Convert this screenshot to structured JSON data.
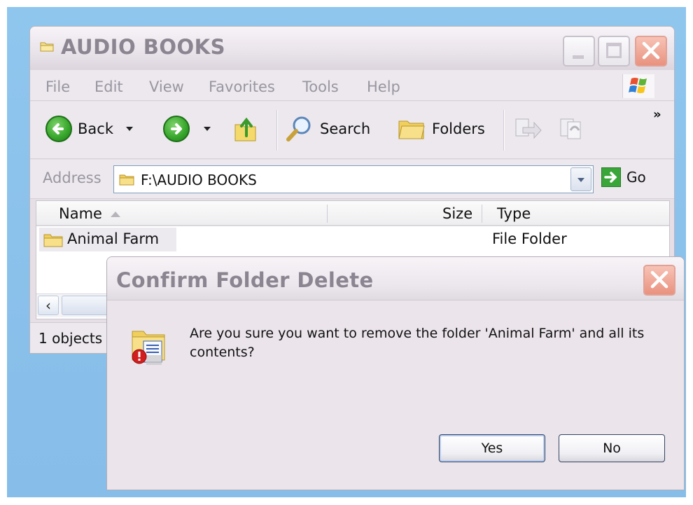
{
  "explorer": {
    "title": "AUDIO BOOKS",
    "menu": [
      "File",
      "Edit",
      "View",
      "Favorites",
      "Tools",
      "Help"
    ],
    "toolbar": {
      "back_label": "Back",
      "search_label": "Search",
      "folders_label": "Folders",
      "overflow": "»"
    },
    "address": {
      "label": "Address",
      "value": "F:\\AUDIO BOOKS",
      "go_label": "Go"
    },
    "columns": {
      "name": "Name",
      "size": "Size",
      "type": "Type"
    },
    "rows": [
      {
        "name": "Animal Farm",
        "size": "",
        "type": "File Folder"
      }
    ],
    "status": "1 objects"
  },
  "dialog": {
    "title": "Confirm Folder Delete",
    "message": "Are you sure you want to remove the folder 'Animal Farm' and all its contents?",
    "yes_label": "Yes",
    "no_label": "No"
  },
  "colors": {
    "desktop": "#8fc6ee",
    "window_face": "#ece8ee",
    "title_text": "#8a8590",
    "close_button": "#e9927f",
    "go_arrow": "#3aa63a"
  }
}
